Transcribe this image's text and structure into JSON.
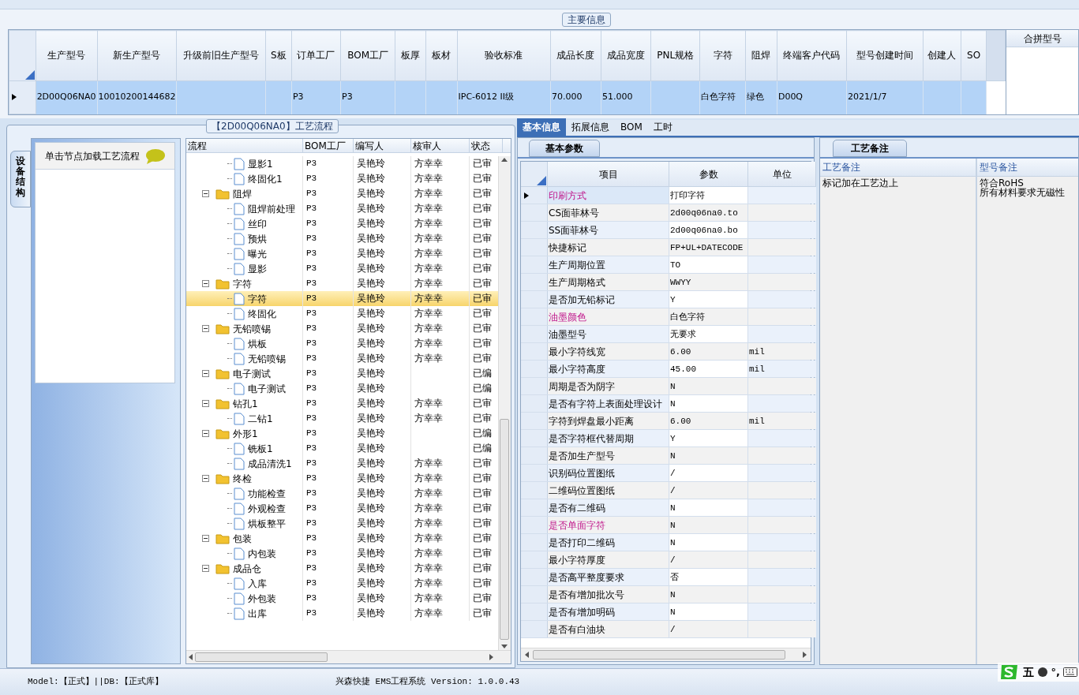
{
  "main_info": {
    "title": "主要信息",
    "columns": [
      "生产型号",
      "新生产型号",
      "升级前旧生产型号",
      "S板",
      "订单工厂",
      "BOM工厂",
      "板厚",
      "板材",
      "验收标准",
      "成品长度",
      "成品宽度",
      "PNL规格",
      "字符",
      "阻焊",
      "终端客户代码",
      "型号创建时间",
      "创建人",
      "SO"
    ],
    "rows": [
      {
        "selected": true,
        "cells": [
          "2D00Q06NA0",
          "10010200144682",
          null,
          null,
          "P3",
          "P3",
          null,
          null,
          "IPC-6012 II级",
          "70.000",
          "51.000",
          null,
          "白色字符",
          "绿色",
          "D00Q",
          "2021/1/7",
          null,
          null
        ]
      }
    ],
    "merge_panel": {
      "title": "合拼型号"
    }
  },
  "flow": {
    "title": "【2D00Q06NA0】工艺流程",
    "side_tab": "设备结构",
    "hint": "单击节点加载工艺流程",
    "columns": [
      "流程",
      "BOM工厂",
      "编写人",
      "核审人",
      "状态"
    ],
    "nodes": [
      {
        "children": [
          {
            "label": "显影1",
            "bom": "P3",
            "writer": "吴艳玲",
            "reviewer": "方幸幸",
            "status": "已审",
            "selected": false
          },
          {
            "label": "终固化1",
            "bom": "P3",
            "writer": "吴艳玲",
            "reviewer": "方幸幸",
            "status": "已审",
            "selected": false
          }
        ]
      },
      {
        "label": "阻焊",
        "bom": "P3",
        "writer": "吴艳玲",
        "reviewer": "方幸幸",
        "status": "已审",
        "selected": false,
        "expanded": true,
        "children": [
          {
            "label": "阻焊前处理",
            "bom": "P3",
            "writer": "吴艳玲",
            "reviewer": "方幸幸",
            "status": "已审",
            "selected": false
          },
          {
            "label": "丝印",
            "bom": "P3",
            "writer": "吴艳玲",
            "reviewer": "方幸幸",
            "status": "已审",
            "selected": false
          },
          {
            "label": "预烘",
            "bom": "P3",
            "writer": "吴艳玲",
            "reviewer": "方幸幸",
            "status": "已审",
            "selected": false
          },
          {
            "label": "曝光",
            "bom": "P3",
            "writer": "吴艳玲",
            "reviewer": "方幸幸",
            "status": "已审",
            "selected": false
          },
          {
            "label": "显影",
            "bom": "P3",
            "writer": "吴艳玲",
            "reviewer": "方幸幸",
            "status": "已审",
            "selected": false
          }
        ]
      },
      {
        "label": "字符",
        "bom": "P3",
        "writer": "吴艳玲",
        "reviewer": "方幸幸",
        "status": "已审",
        "selected": false,
        "expanded": true,
        "children": [
          {
            "label": "字符",
            "bom": "P3",
            "writer": "吴艳玲",
            "reviewer": "方幸幸",
            "status": "已审",
            "selected": true
          },
          {
            "label": "终固化",
            "bom": "P3",
            "writer": "吴艳玲",
            "reviewer": "方幸幸",
            "status": "已审",
            "selected": false
          }
        ]
      },
      {
        "label": "无铅喷锡",
        "bom": "P3",
        "writer": "吴艳玲",
        "reviewer": "方幸幸",
        "status": "已审",
        "selected": false,
        "expanded": true,
        "children": [
          {
            "label": "烘板",
            "bom": "P3",
            "writer": "吴艳玲",
            "reviewer": "方幸幸",
            "status": "已审",
            "selected": false
          },
          {
            "label": "无铅喷锡",
            "bom": "P3",
            "writer": "吴艳玲",
            "reviewer": "方幸幸",
            "status": "已审",
            "selected": false
          }
        ]
      },
      {
        "label": "电子测试",
        "bom": "P3",
        "writer": "吴艳玲",
        "status": "已编",
        "selected": false,
        "expanded": true,
        "children": [
          {
            "label": "电子测试",
            "bom": "P3",
            "writer": "吴艳玲",
            "status": "已编",
            "selected": false
          }
        ]
      },
      {
        "label": "钻孔1",
        "bom": "P3",
        "writer": "吴艳玲",
        "reviewer": "方幸幸",
        "status": "已审",
        "selected": false,
        "expanded": true,
        "children": [
          {
            "label": "二钻1",
            "bom": "P3",
            "writer": "吴艳玲",
            "reviewer": "方幸幸",
            "status": "已审",
            "selected": false
          }
        ]
      },
      {
        "label": "外形1",
        "bom": "P3",
        "writer": "吴艳玲",
        "status": "已编",
        "selected": false,
        "expanded": true,
        "children": [
          {
            "label": "铣板1",
            "bom": "P3",
            "writer": "吴艳玲",
            "status": "已编",
            "selected": false
          },
          {
            "label": "成品清洗1",
            "bom": "P3",
            "writer": "吴艳玲",
            "reviewer": "方幸幸",
            "status": "已审",
            "selected": false
          }
        ]
      },
      {
        "label": "终检",
        "bom": "P3",
        "writer": "吴艳玲",
        "reviewer": "方幸幸",
        "status": "已审",
        "selected": false,
        "expanded": true,
        "children": [
          {
            "label": "功能检查",
            "bom": "P3",
            "writer": "吴艳玲",
            "reviewer": "方幸幸",
            "status": "已审",
            "selected": false
          },
          {
            "label": "外观检查",
            "bom": "P3",
            "writer": "吴艳玲",
            "reviewer": "方幸幸",
            "status": "已审",
            "selected": false
          },
          {
            "label": "烘板整平",
            "bom": "P3",
            "writer": "吴艳玲",
            "reviewer": "方幸幸",
            "status": "已审",
            "selected": false
          }
        ]
      },
      {
        "label": "包装",
        "bom": "P3",
        "writer": "吴艳玲",
        "reviewer": "方幸幸",
        "status": "已审",
        "selected": false,
        "expanded": true,
        "children": [
          {
            "label": "内包装",
            "bom": "P3",
            "writer": "吴艳玲",
            "reviewer": "方幸幸",
            "status": "已审",
            "selected": false
          }
        ]
      },
      {
        "label": "成品仓",
        "bom": "P3",
        "writer": "吴艳玲",
        "reviewer": "方幸幸",
        "status": "已审",
        "selected": false,
        "expanded": true,
        "children": [
          {
            "label": "入库",
            "bom": "P3",
            "writer": "吴艳玲",
            "reviewer": "方幸幸",
            "status": "已审",
            "selected": false
          },
          {
            "label": "外包装",
            "bom": "P3",
            "writer": "吴艳玲",
            "reviewer": "方幸幸",
            "status": "已审",
            "selected": false
          },
          {
            "label": "出库",
            "bom": "P3",
            "writer": "吴艳玲",
            "reviewer": "方幸幸",
            "status": "已审",
            "selected": false
          }
        ]
      }
    ]
  },
  "tabs": [
    {
      "label": "基本信息",
      "selected": true
    },
    {
      "label": "拓展信息",
      "selected": false
    },
    {
      "label": "BOM",
      "selected": false
    },
    {
      "label": "工时",
      "selected": false
    }
  ],
  "params": {
    "title": "基本参数",
    "columns": [
      "项目",
      "参数",
      "单位"
    ],
    "rows": [
      {
        "item": "印刷方式",
        "value": "打印字符",
        "flagged": true,
        "selected": true
      },
      {
        "item": "CS面菲林号",
        "value": "2d00q06na0.to",
        "flagged": false,
        "selected": false
      },
      {
        "item": "SS面菲林号",
        "value": "2d00q06na0.bo",
        "flagged": false,
        "selected": false
      },
      {
        "item": "快捷标记",
        "value": "FP+UL+DATECODE",
        "flagged": false,
        "selected": false
      },
      {
        "item": "生产周期位置",
        "value": "TO",
        "flagged": false,
        "selected": false
      },
      {
        "item": "生产周期格式",
        "value": "WWYY",
        "flagged": false,
        "selected": false
      },
      {
        "item": "是否加无铅标记",
        "value": "Y",
        "flagged": false,
        "selected": false
      },
      {
        "item": "油墨颜色",
        "value": "白色字符",
        "flagged": true,
        "selected": false
      },
      {
        "item": "油墨型号",
        "value": "无要求",
        "flagged": false,
        "selected": false
      },
      {
        "item": "最小字符线宽",
        "value": "6.00",
        "unit": "mil",
        "flagged": false,
        "selected": false
      },
      {
        "item": "最小字符高度",
        "value": "45.00",
        "unit": "mil",
        "flagged": false,
        "selected": false
      },
      {
        "item": "周期是否为阴字",
        "value": "N",
        "flagged": false,
        "selected": false
      },
      {
        "item": "是否有字符上表面处理设计",
        "value": "N",
        "flagged": false,
        "selected": false
      },
      {
        "item": "字符到焊盘最小距离",
        "value": "6.00",
        "unit": "mil",
        "flagged": false,
        "selected": false
      },
      {
        "item": "是否字符框代替周期",
        "value": "Y",
        "flagged": false,
        "selected": false
      },
      {
        "item": "是否加生产型号",
        "value": "N",
        "flagged": false,
        "selected": false
      },
      {
        "item": "识别码位置图纸",
        "value": "/",
        "flagged": false,
        "selected": false
      },
      {
        "item": "二维码位置图纸",
        "value": "/",
        "flagged": false,
        "selected": false
      },
      {
        "item": "是否有二维码",
        "value": "N",
        "flagged": false,
        "selected": false
      },
      {
        "item": "是否单面字符",
        "value": "N",
        "flagged": true,
        "selected": false
      },
      {
        "item": "是否打印二维码",
        "value": "N",
        "flagged": false,
        "selected": false
      },
      {
        "item": "最小字符厚度",
        "value": "/",
        "flagged": false,
        "selected": false
      },
      {
        "item": "是否高平整度要求",
        "value": "否",
        "flagged": false,
        "selected": false
      },
      {
        "item": "是否有增加批次号",
        "value": "N",
        "flagged": false,
        "selected": false
      },
      {
        "item": "是否有增加明码",
        "value": "N",
        "flagged": false,
        "selected": false
      },
      {
        "item": "是否有白油块",
        "value": "/",
        "flagged": false,
        "selected": false
      }
    ]
  },
  "notes": {
    "title": "工艺备注",
    "columns": [
      {
        "header": "工艺备注",
        "lines": [
          "标记加在工艺边上"
        ]
      },
      {
        "header": "型号备注",
        "lines": [
          "符合RoHS",
          "所有材料要求无磁性"
        ]
      }
    ]
  },
  "status_bar": {
    "left": "Model:【正式】||DB:【正式库】",
    "center": "兴森快捷 EMS工程系统 Version: 1.0.0.43"
  },
  "ime": {
    "mode": "五",
    "punct": "°,"
  }
}
